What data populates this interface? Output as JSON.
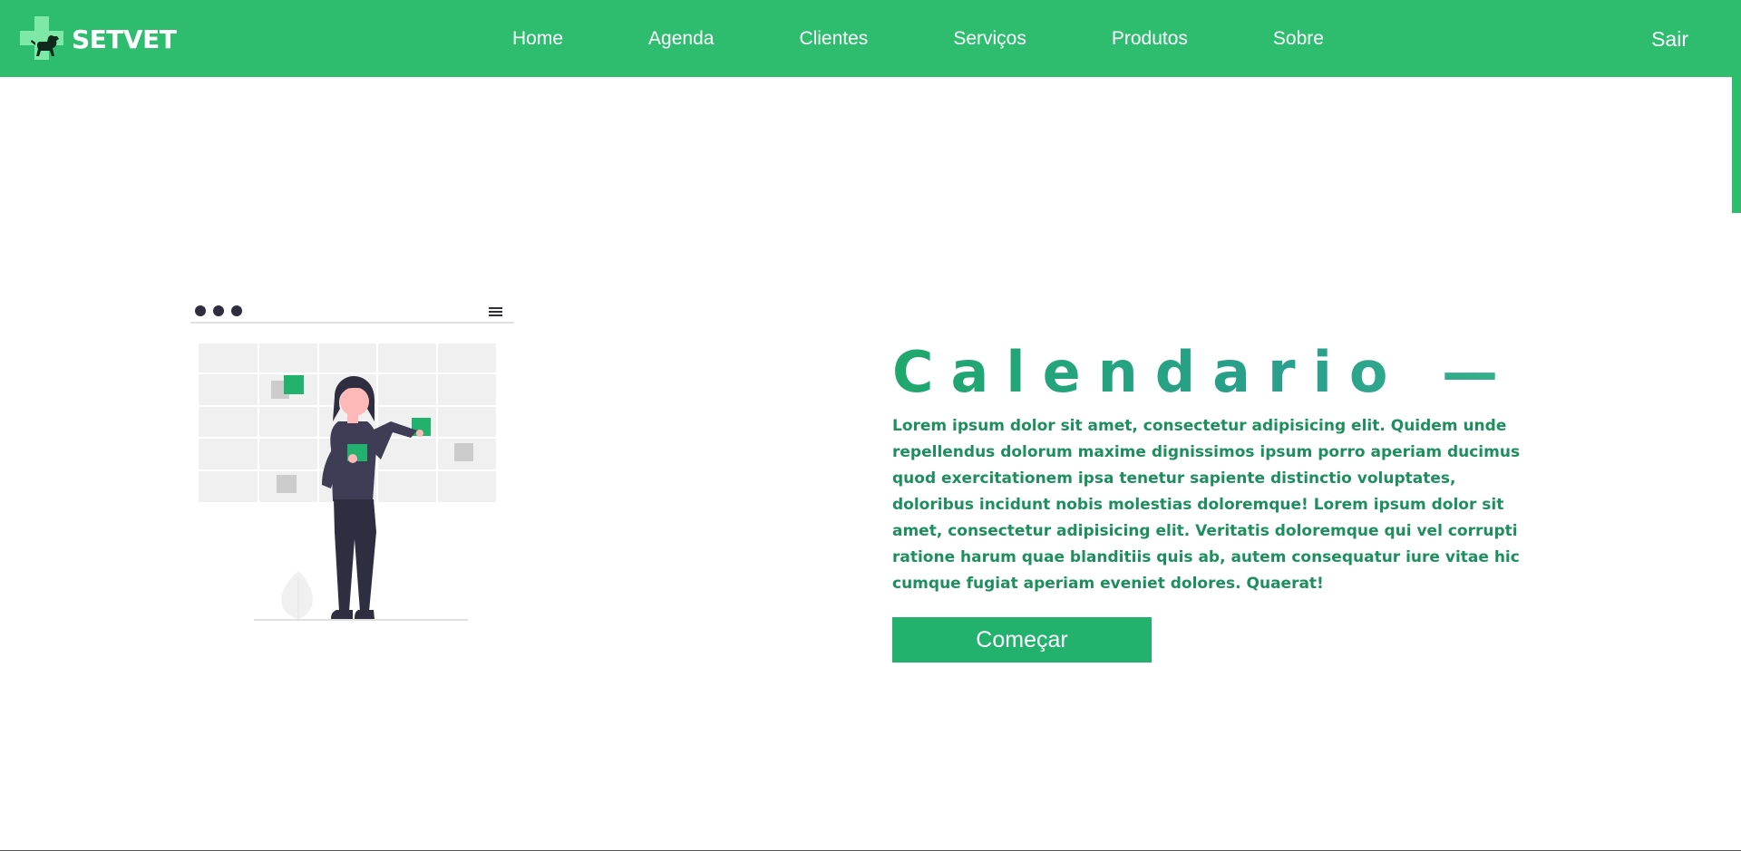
{
  "brand": {
    "name": "SETVET",
    "logo_icon": "cross-with-dog-icon",
    "logo_color": "#7ee8a6"
  },
  "nav": {
    "items": [
      {
        "label": "Home"
      },
      {
        "label": "Agenda"
      },
      {
        "label": "Clientes"
      },
      {
        "label": "Serviços"
      },
      {
        "label": "Produtos"
      },
      {
        "label": "Sobre"
      }
    ],
    "logout_label": "Sair"
  },
  "hero": {
    "title": "Calendario —",
    "description": "Lorem ipsum dolor sit amet, consectetur adipisicing elit. Quidem unde repellendus dolorum maxime dignissimos ipsum porro aperiam ducimus quod exercitationem ipsa tenetur sapiente distinctio voluptates, doloribus incidunt nobis molestias doloremque! Lorem ipsum dolor sit amet, consectetur adipisicing elit. Veritatis doloremque qui vel corrupti ratione harum quae blanditiis quis ab, autem consequatur iure vitae hic cumque fugiat aperiam eveniet dolores. Quaerat!",
    "button_label": "Começar",
    "illustration_icon": "calendar-illustration"
  },
  "colors": {
    "primary": "#2ebd6f",
    "button": "#23b26d",
    "text_green": "#1d8f5d",
    "dark_figure": "#2f2e41"
  }
}
